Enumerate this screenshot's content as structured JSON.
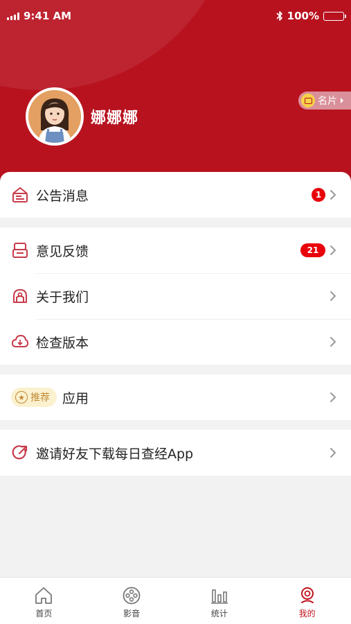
{
  "status_bar": {
    "time": "9:41 AM",
    "battery": "100%"
  },
  "profile": {
    "name": "娜娜娜",
    "card_label": "名片"
  },
  "menu": {
    "announcements": {
      "label": "公告消息",
      "badge": "1"
    },
    "feedback": {
      "label": "意见反馈",
      "badge": "21"
    },
    "about": {
      "label": "关于我们"
    },
    "check_version": {
      "label": "检查版本"
    },
    "apps": {
      "tag": "推荐",
      "label": "应用"
    },
    "invite": {
      "label": "邀请好友下载每日查经App"
    }
  },
  "tabbar": {
    "items": [
      {
        "label": "首页",
        "icon": "home-icon"
      },
      {
        "label": "影音",
        "icon": "film-reel-icon"
      },
      {
        "label": "统计",
        "icon": "bar-chart-icon"
      },
      {
        "label": "我的",
        "icon": "user-profile-icon",
        "active": true
      }
    ]
  },
  "colors": {
    "brand": "#b8121f",
    "badge": "#e8000b",
    "tag_bg": "#fbf1cf",
    "tag_text": "#c08b35"
  }
}
